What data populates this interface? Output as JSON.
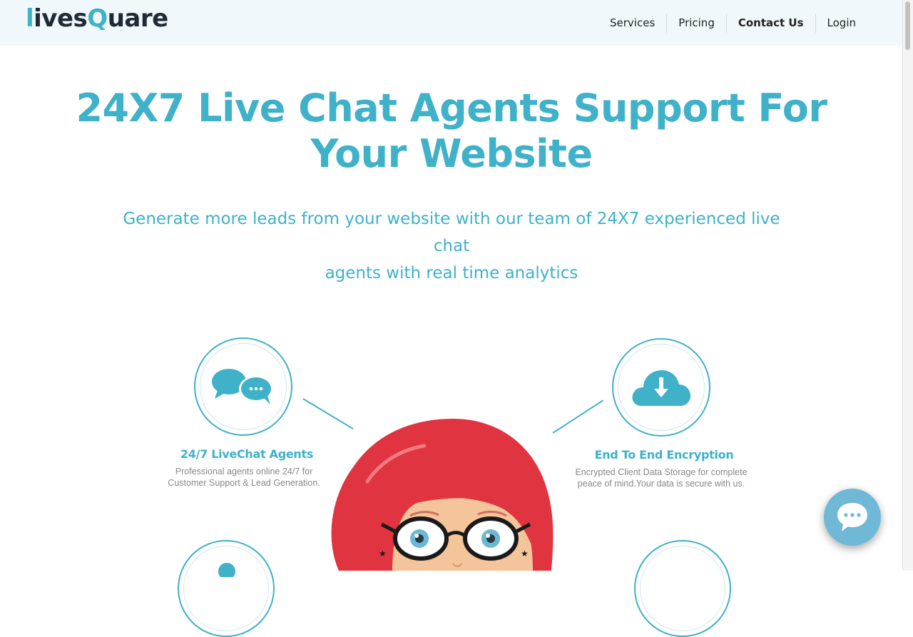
{
  "brand": {
    "logo_prefix": "l",
    "logo_mid": "ives",
    "logo_q": "Q",
    "logo_suffix": "uare"
  },
  "nav": {
    "services": "Services",
    "pricing": "Pricing",
    "contact": "Contact Us",
    "login": "Login"
  },
  "hero": {
    "title_line1": "24X7 Live Chat Agents Support For",
    "title_line2": "Your Website",
    "subtitle_line1": "Generate more leads from your website with our team of 24X7 experienced live chat",
    "subtitle_line2": "agents with real time analytics"
  },
  "features": {
    "livechat": {
      "title": "24/7 LiveChat Agents",
      "desc_line1": "Professional agents online 24/7 for",
      "desc_line2": "Customer Support & Lead Generation.",
      "icon": "chat-bubbles-icon"
    },
    "encryption": {
      "title": "End To End Encryption",
      "desc_line1": "Encrypted Client Data Storage for complete",
      "desc_line2": "peace of mind.Your data is secure with us.",
      "icon": "cloud-download-icon"
    }
  },
  "colors": {
    "accent": "#3fb1c9",
    "header_bg": "#f0f8fb",
    "hair": "#e03440",
    "chat_button": "#6fb8d6"
  }
}
